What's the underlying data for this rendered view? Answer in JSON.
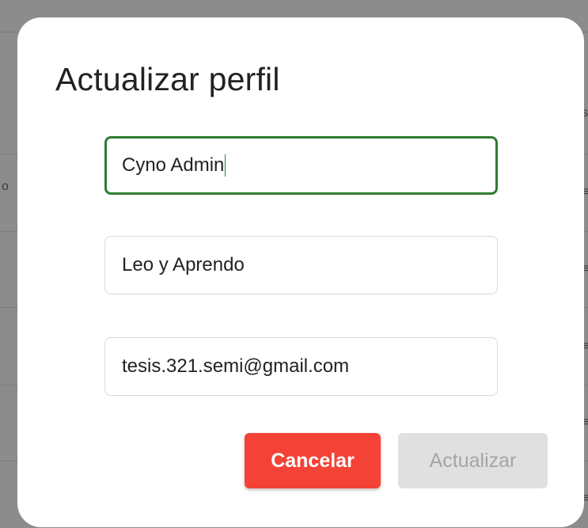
{
  "dialog": {
    "title": "Actualizar perfil",
    "fields": [
      {
        "name": "nombre",
        "value": "Cyno Admin",
        "focused": true
      },
      {
        "name": "institucion",
        "value": "Leo y Aprendo",
        "focused": false
      },
      {
        "name": "email",
        "value": "tesis.321.semi@gmail.com",
        "focused": false
      }
    ],
    "buttons": {
      "cancel_label": "Cancelar",
      "update_label": "Actualizar",
      "update_disabled": true
    }
  },
  "colors": {
    "focus_border": "#2e7d32",
    "cancel_bg": "#f44336",
    "update_bg_disabled": "#e0e0e0",
    "update_text_disabled": "#a5a5a5",
    "backdrop": "#8c8c8c"
  }
}
